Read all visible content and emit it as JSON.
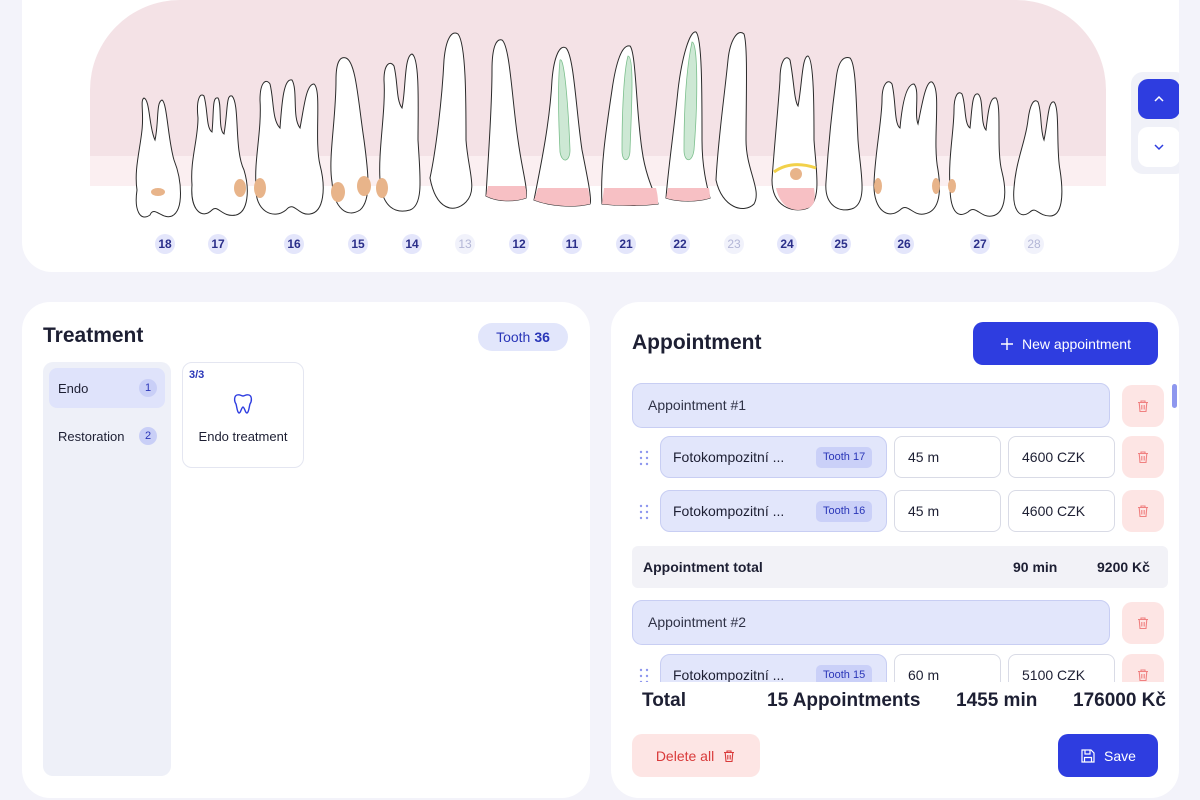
{
  "dental_chart": {
    "teeth": [
      {
        "number": "18",
        "present": true
      },
      {
        "number": "17",
        "present": true
      },
      {
        "number": "16",
        "present": true
      },
      {
        "number": "15",
        "present": true
      },
      {
        "number": "14",
        "present": true
      },
      {
        "number": "13",
        "present": false
      },
      {
        "number": "12",
        "present": true
      },
      {
        "number": "11",
        "present": true
      },
      {
        "number": "21",
        "present": true
      },
      {
        "number": "22",
        "present": true
      },
      {
        "number": "23",
        "present": false
      },
      {
        "number": "24",
        "present": true
      },
      {
        "number": "25",
        "present": true
      },
      {
        "number": "26",
        "present": true
      },
      {
        "number": "27",
        "present": true
      },
      {
        "number": "28",
        "present": false
      }
    ],
    "arch_switch": {
      "up_icon": "chevron-up-icon",
      "down_icon": "chevron-down-icon",
      "selected": "up"
    }
  },
  "treatment": {
    "title": "Treatment",
    "tooth_label": "Tooth",
    "tooth_number": "36",
    "categories": [
      {
        "label": "Endo",
        "count": "1",
        "active": true
      },
      {
        "label": "Restoration",
        "count": "2",
        "active": false
      }
    ],
    "cards": [
      {
        "count": "3/3",
        "icon": "tooth-icon",
        "label": "Endo treatment"
      }
    ]
  },
  "appointment": {
    "title": "Appointment",
    "new_button": "New appointment",
    "groups": [
      {
        "header": "Appointment #1",
        "items": [
          {
            "name": "Fotokompozitní ...",
            "tooth": "Tooth 17",
            "duration": "45 m",
            "price": "4600 CZK"
          },
          {
            "name": "Fotokompozitní ...",
            "tooth": "Tooth 16",
            "duration": "45 m",
            "price": "4600 CZK"
          }
        ],
        "total_label": "Appointment total",
        "total_duration": "90 min",
        "total_price": "9200 Kč"
      },
      {
        "header": "Appointment #2",
        "items": [
          {
            "name": "Fotokompozitní ...",
            "tooth": "Tooth 15",
            "duration": "60 m",
            "price": "5100 CZK"
          }
        ]
      }
    ],
    "total": {
      "label": "Total",
      "appointments": "15 Appointments",
      "duration": "1455 min",
      "price": "176000 Kč"
    },
    "delete_all": "Delete all",
    "save": "Save"
  },
  "colors": {
    "accent": "#2e3de0",
    "gum": "#f4e2e6",
    "danger": "#d93a3a",
    "danger_bg": "#fde5e4",
    "pill_bg": "#e2e6fb"
  }
}
